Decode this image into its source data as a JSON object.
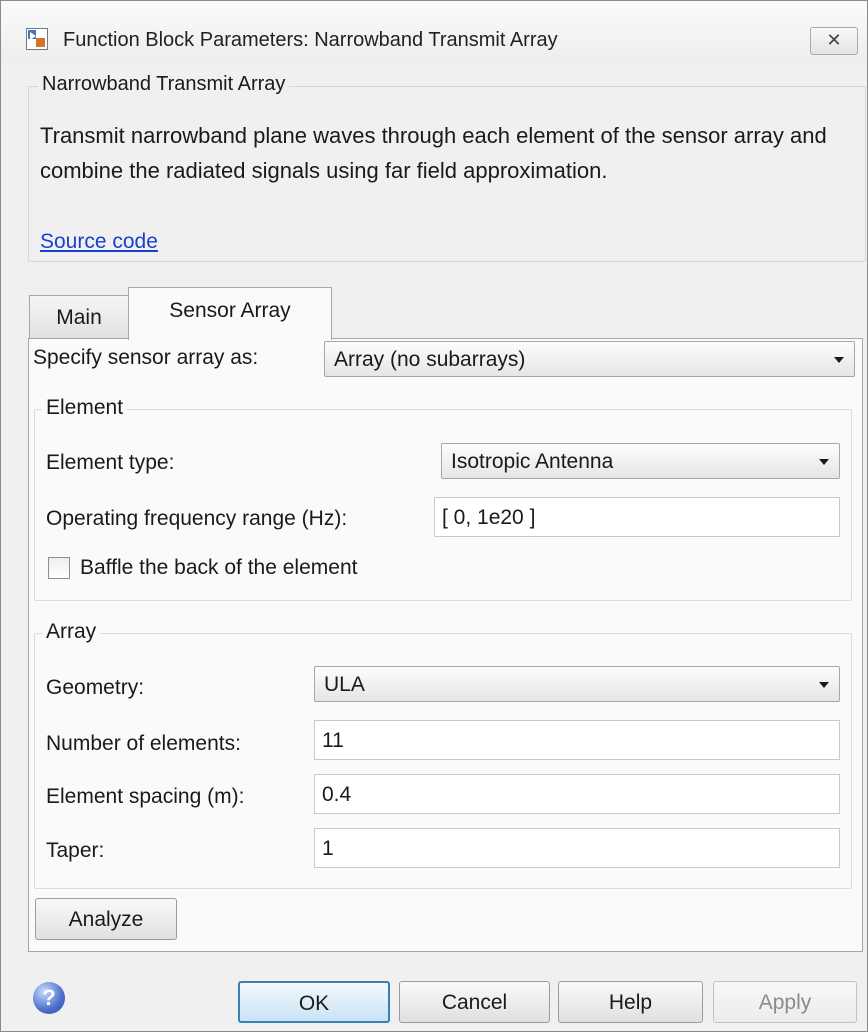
{
  "window": {
    "title": "Function Block Parameters: Narrowband Transmit Array",
    "close_glyph": "✕"
  },
  "description": {
    "block_name": "Narrowband Transmit Array",
    "text": "Transmit narrowband plane waves through each element of the sensor array and combine the radiated signals using far field approximation.",
    "source_link": "Source code"
  },
  "tabs": [
    {
      "label": "Main",
      "active": false
    },
    {
      "label": "Sensor Array",
      "active": true
    }
  ],
  "sensor_array": {
    "specify_label": "Specify sensor array as:",
    "specify_value": "Array (no subarrays)",
    "element": {
      "legend": "Element",
      "type_label": "Element type:",
      "type_value": "Isotropic Antenna",
      "freq_label": "Operating frequency range (Hz):",
      "freq_value": "[ 0, 1e20 ]",
      "baffle_label": "Baffle the back of the element",
      "baffle_checked": false
    },
    "array": {
      "legend": "Array",
      "geometry_label": "Geometry:",
      "geometry_value": "ULA",
      "num_label": "Number of elements:",
      "num_value": "11",
      "spacing_label": "Element spacing (m):",
      "spacing_value": "0.4",
      "taper_label": "Taper:",
      "taper_value": "1"
    },
    "analyze_label": "Analyze"
  },
  "footer": {
    "ok": "OK",
    "cancel": "Cancel",
    "help": "Help",
    "apply": "Apply",
    "help_icon_glyph": "?"
  },
  "colors": {
    "link": "#1a3fd1",
    "ok_border": "#3c7fb1",
    "dialog_bg": "#f0f0f0",
    "panel_bg": "#fafafa"
  }
}
